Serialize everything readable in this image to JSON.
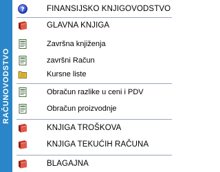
{
  "sidebar": {
    "title": "RAČUNOVODSTVO",
    "color": "#2a86c8"
  },
  "menu": {
    "items": [
      {
        "label": "FINANSIJSKO KNJIGOVODSTVO",
        "icon": "help-icon"
      },
      {
        "label": "GLAVNA KNJIGA",
        "icon": "book-icon"
      },
      {
        "label": "Završna knjiženja",
        "icon": "document-icon"
      },
      {
        "label": "završni Račun",
        "icon": "document-icon"
      },
      {
        "label": "Kursne liste",
        "icon": "folder-icon"
      },
      {
        "label": "Obračun razlike u ceni i PDV",
        "icon": "document-icon"
      },
      {
        "label": "Obračun proizvodnje",
        "icon": "document-icon"
      },
      {
        "label": "KNJIGA TROŠKOVA",
        "icon": "book-icon"
      },
      {
        "label": "KNJIGA TEKUĆIH RAČUNA",
        "icon": "book-icon"
      },
      {
        "label": "BLAGAJNA",
        "icon": "book-icon"
      }
    ]
  }
}
